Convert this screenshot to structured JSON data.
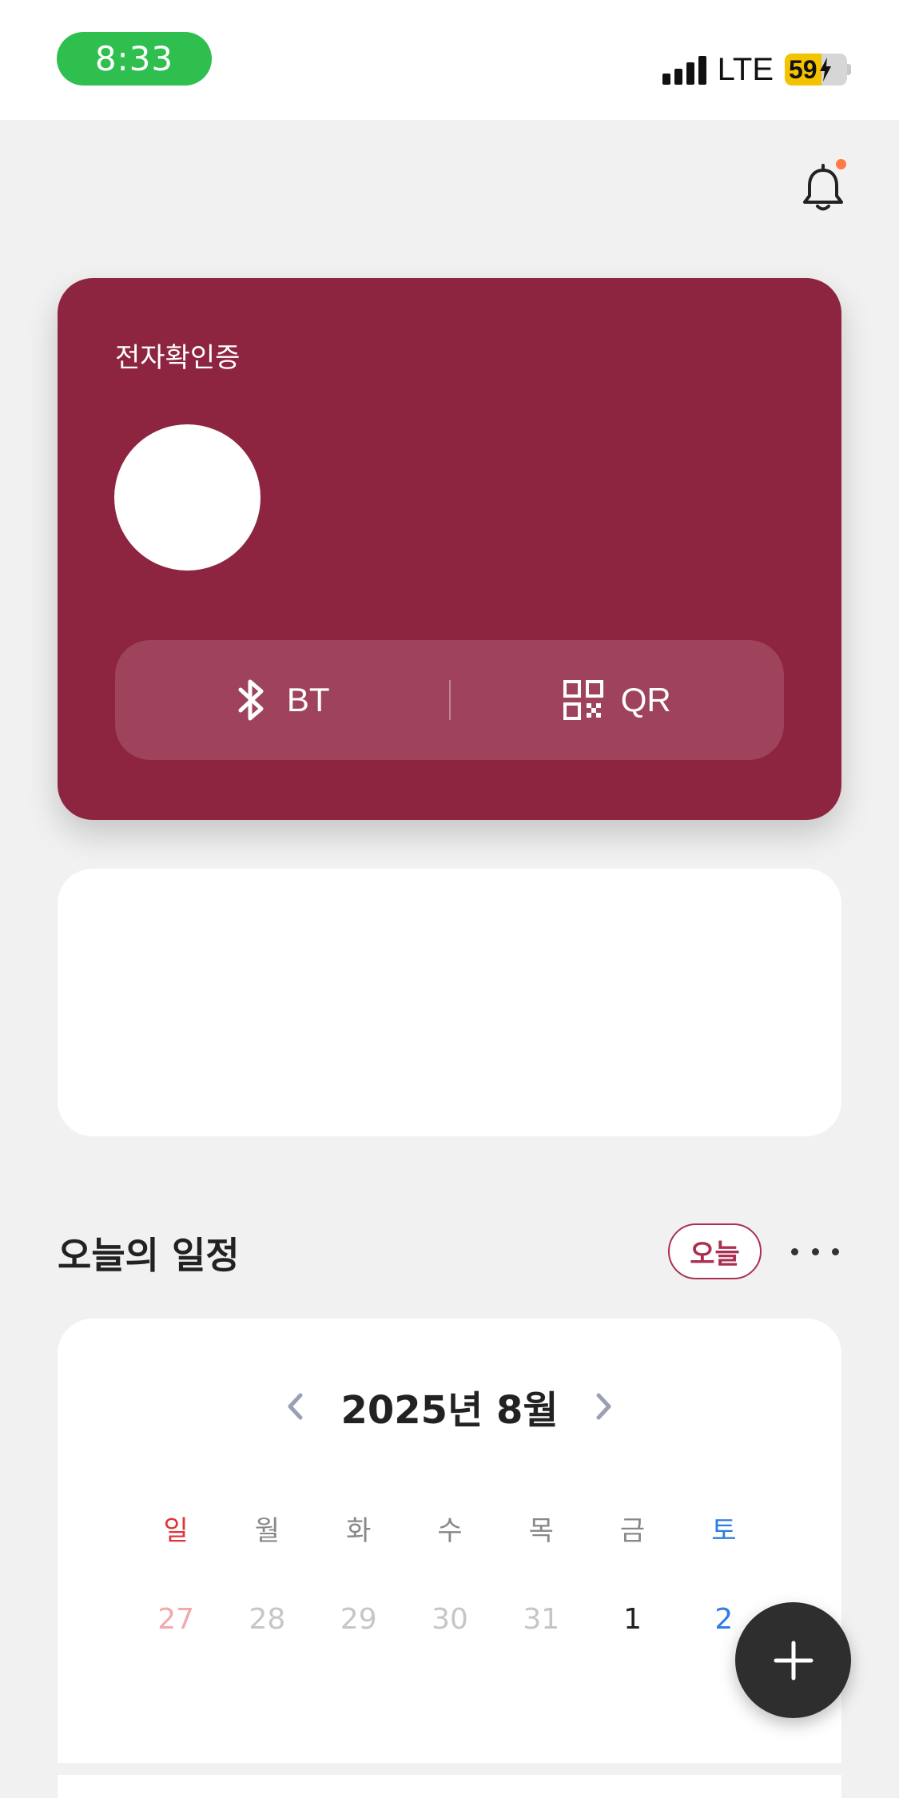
{
  "status_bar": {
    "time": "8:33",
    "network": "LTE",
    "battery": "59",
    "battery_level": 0.59,
    "time_pill_color": "#2fbf4f",
    "battery_color": "#f3c300"
  },
  "header": {
    "notification_icon": "bell-icon",
    "has_unread_dot": true,
    "dot_color": "#ff7a45"
  },
  "id_card": {
    "title": "전자확인증",
    "background_color": "#8e2540",
    "bt_label": "BT",
    "qr_label": "QR",
    "bt_icon": "bluetooth-icon",
    "qr_icon": "qr-code-icon"
  },
  "schedule": {
    "section_title": "오늘의 일정",
    "today_button": "오늘",
    "more_icon": "more-horizontal-icon"
  },
  "calendar": {
    "month_label": "2025년 8월",
    "prev_icon": "chevron-left-icon",
    "next_icon": "chevron-right-icon",
    "weekdays": [
      "일",
      "월",
      "화",
      "수",
      "목",
      "금",
      "토"
    ],
    "first_week": [
      "27",
      "28",
      "29",
      "30",
      "31",
      "1",
      "2"
    ]
  },
  "fab": {
    "icon": "plus-icon"
  }
}
